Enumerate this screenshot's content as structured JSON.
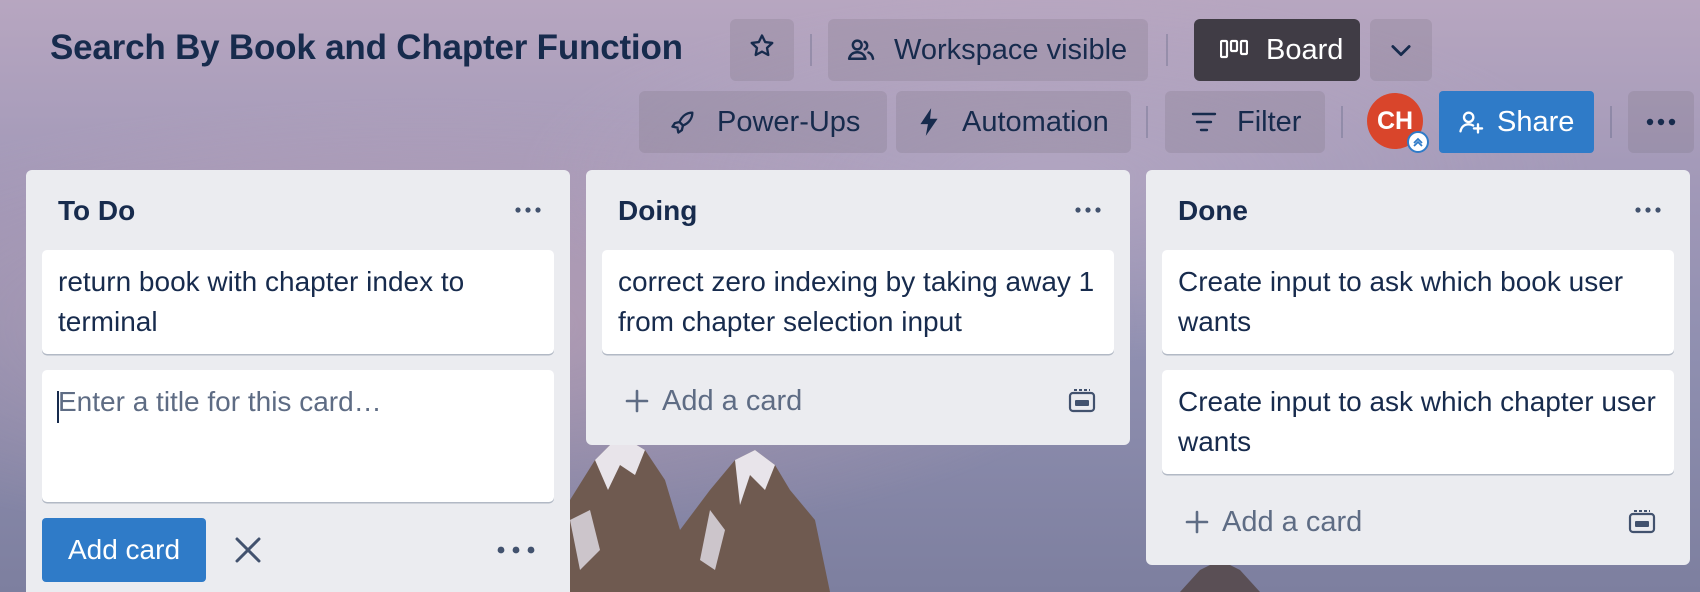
{
  "board": {
    "title": "Search By Book and Chapter Function"
  },
  "header": {
    "star_icon": "star-icon",
    "visibility_label": "Workspace visible",
    "view_label": "Board",
    "powerups_label": "Power-Ups",
    "automation_label": "Automation",
    "filter_label": "Filter",
    "avatar_initials": "CH",
    "share_label": "Share"
  },
  "lists": [
    {
      "title": "To Do",
      "cards": [
        "return book with chapter index to terminal"
      ],
      "composer": {
        "placeholder": "Enter a title for this card…",
        "value": "",
        "submit_label": "Add card"
      }
    },
    {
      "title": "Doing",
      "cards": [
        "correct zero indexing by taking away 1 from chapter selection input"
      ],
      "add_label": "Add a card"
    },
    {
      "title": "Done",
      "cards": [
        "Create input to ask which book user wants",
        "Create input to ask which chapter user wants"
      ],
      "add_label": "Add a card"
    }
  ],
  "colors": {
    "primary": "#2f7bc8",
    "board_button": "#403c45",
    "avatar": "#d9452b",
    "list_bg": "#ebecf0",
    "text": "#172b4d"
  }
}
